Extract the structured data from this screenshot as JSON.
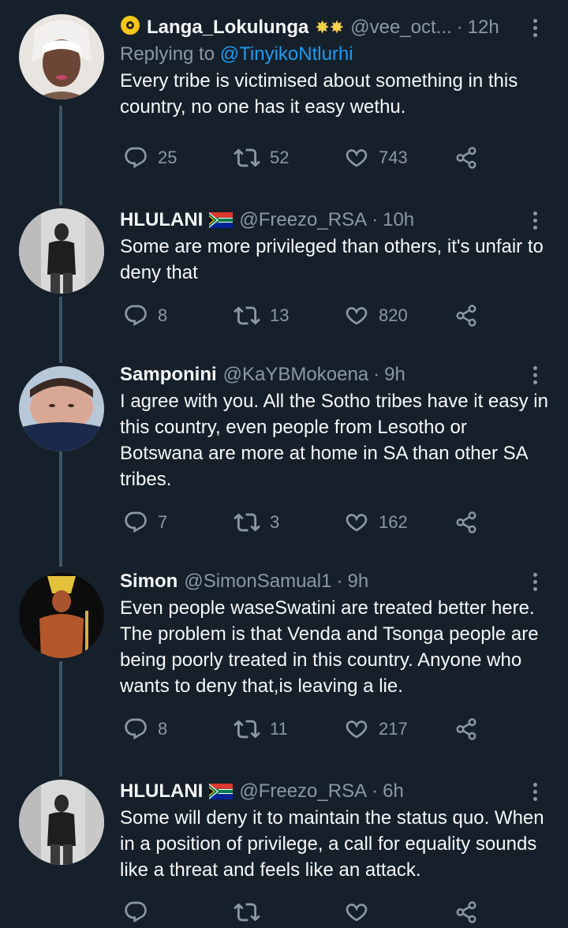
{
  "tweets": [
    {
      "name": "Langa_Lokulunga",
      "name_suffix": "✸✸",
      "handle": "@vee_oct...",
      "time": "12h",
      "replying_label": "Replying to",
      "replying_handle": "@TinyikoNtlurhi",
      "text": "Every tribe is victimised about something in this country, no one has it easy wethu.",
      "replies": "25",
      "retweets": "52",
      "likes": "743"
    },
    {
      "name": "HLULANI",
      "handle": "@Freezo_RSA",
      "time": "10h",
      "text": "Some are more privileged than others, it's unfair to deny that",
      "replies": "8",
      "retweets": "13",
      "likes": "820"
    },
    {
      "name": "Samponini",
      "handle": "@KaYBMokoena",
      "time": "9h",
      "text": "I agree with you. All the Sotho tribes have it easy in this country, even people from Lesotho or Botswana are more at home in SA than other SA tribes.",
      "replies": "7",
      "retweets": "3",
      "likes": "162"
    },
    {
      "name": "Simon",
      "handle": "@SimonSamual1",
      "time": "9h",
      "text": "Even people waseSwatini are treated better here. The problem is that Venda and Tsonga people are being poorly treated in this country. Anyone who wants to deny that,is leaving a lie.",
      "replies": "8",
      "retweets": "11",
      "likes": "217"
    },
    {
      "name": "HLULANI",
      "handle": "@Freezo_RSA",
      "time": "6h",
      "text": "Some will deny it to maintain the status quo. When in a position of privilege, a call for equality sounds like a threat and feels like an attack."
    }
  ],
  "separator": "·",
  "colors": {
    "background": "#15202b",
    "link": "#1d9bf0",
    "muted": "#8b98a5",
    "thread_line": "#3d5466"
  },
  "icons": [
    "more-vert-icon",
    "reply-icon",
    "retweet-icon",
    "like-icon",
    "share-icon",
    "south-africa-flag-icon",
    "spinner-badge-icon"
  ]
}
